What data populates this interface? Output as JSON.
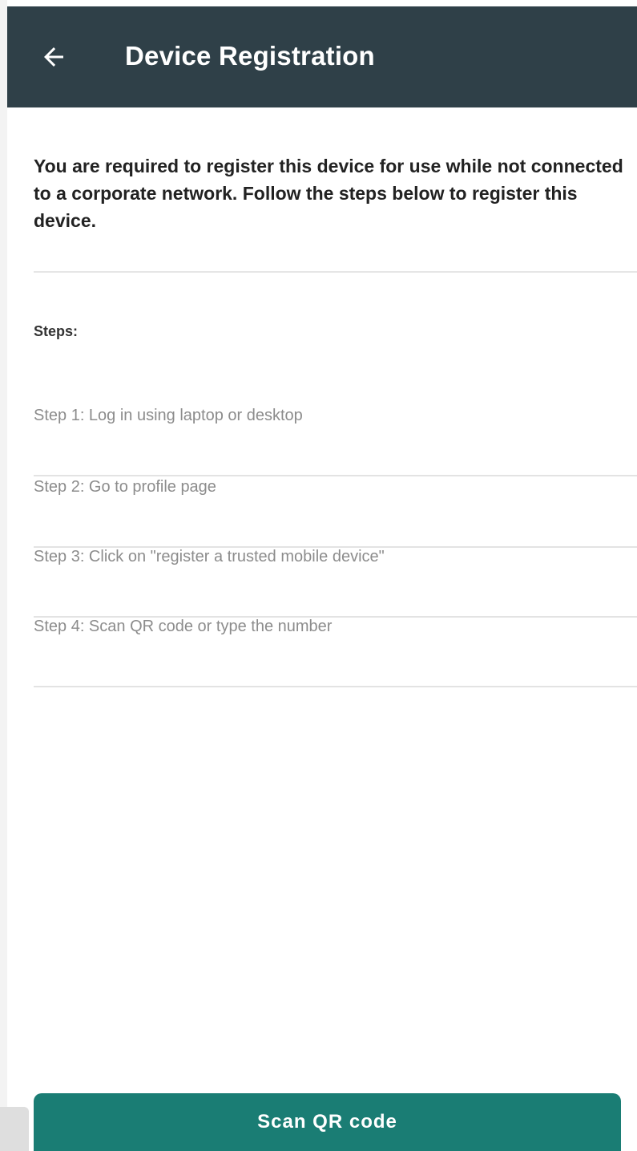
{
  "header": {
    "title": "Device Registration",
    "back_icon": "arrow-left-icon",
    "background": "#2f4048"
  },
  "intro": {
    "text": "You are required to register this device for use while not connected to a corporate network. Follow the steps below to register this device."
  },
  "steps": {
    "heading": "Steps:",
    "items": [
      {
        "label": "Step 1: Log in using laptop or desktop"
      },
      {
        "label": "Step 2: Go to profile page"
      },
      {
        "label": "Step 3: Click on \"register a trusted mobile device\""
      },
      {
        "label": "Step 4: Scan QR code or type the number"
      }
    ]
  },
  "actions": {
    "scan_label": "Scan QR code",
    "accent": "#1a7d74"
  }
}
